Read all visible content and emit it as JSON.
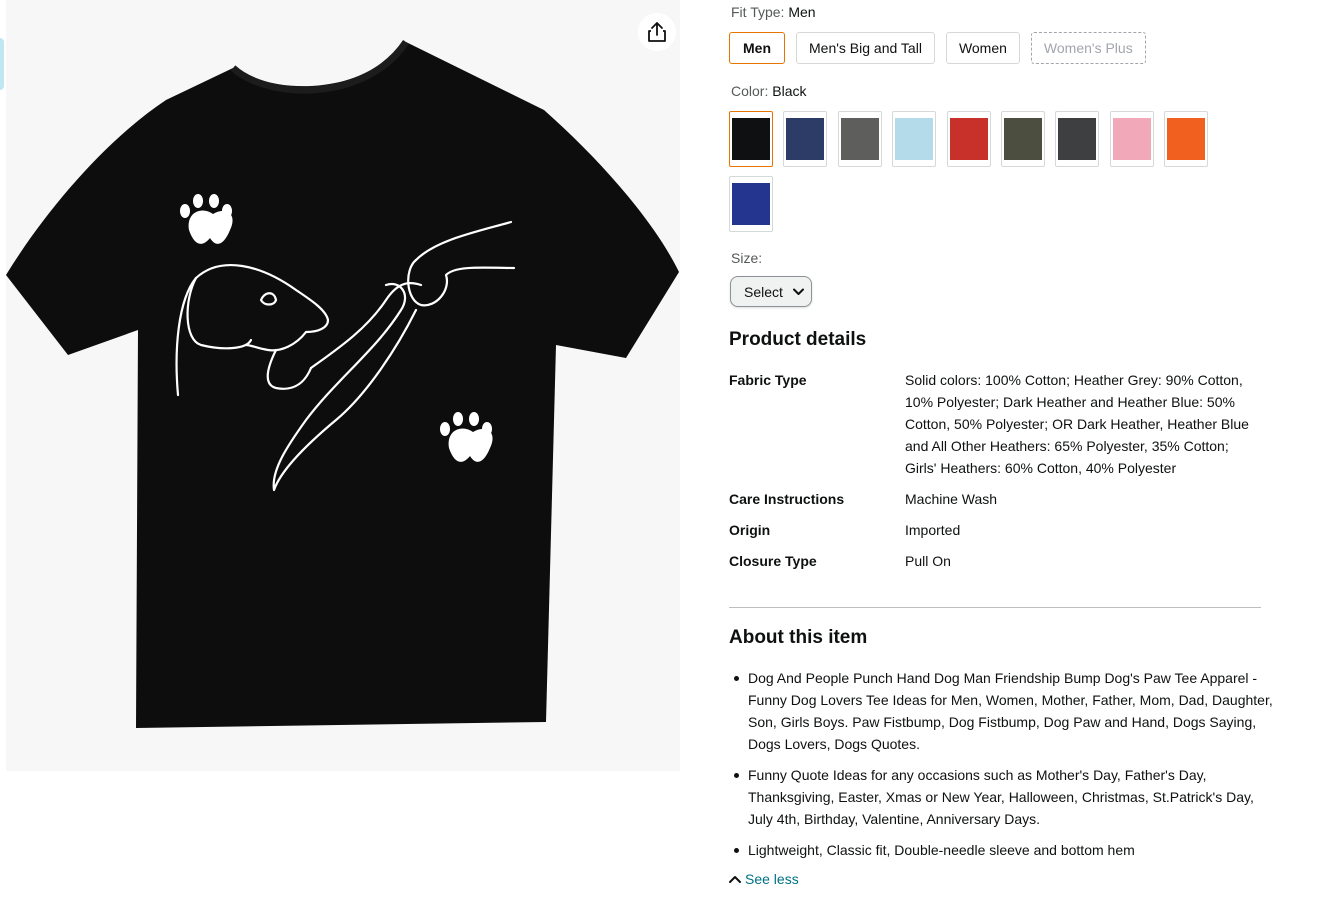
{
  "fit_type": {
    "label": "Fit Type:",
    "value": "Men",
    "options": [
      {
        "label": "Men",
        "state": "selected"
      },
      {
        "label": "Men's Big and Tall",
        "state": "available"
      },
      {
        "label": "Women",
        "state": "available"
      },
      {
        "label": "Women's Plus",
        "state": "unavailable"
      }
    ]
  },
  "color": {
    "label": "Color:",
    "value": "Black",
    "swatches": [
      {
        "name": "Black",
        "hex": "#0e1011",
        "selected": true
      },
      {
        "name": "Navy",
        "hex": "#2c3c66",
        "selected": false
      },
      {
        "name": "Dark Heather",
        "hex": "#5e5f5c",
        "selected": false
      },
      {
        "name": "Baby Blue",
        "hex": "#b4dbea",
        "selected": false
      },
      {
        "name": "Red",
        "hex": "#c8302a",
        "selected": false
      },
      {
        "name": "Olive",
        "hex": "#4c4f40",
        "selected": false
      },
      {
        "name": "Asphalt",
        "hex": "#3d3f40",
        "selected": false
      },
      {
        "name": "Pink",
        "hex": "#f1a8b8",
        "selected": false
      },
      {
        "name": "Orange",
        "hex": "#f1601e",
        "selected": false
      },
      {
        "name": "Royal Blue",
        "hex": "#23358f",
        "selected": false
      }
    ]
  },
  "size": {
    "label": "Size:",
    "select_label": "Select"
  },
  "product_details": {
    "heading": "Product details",
    "rows": [
      {
        "key": "Fabric Type",
        "value": "Solid colors: 100% Cotton; Heather Grey: 90% Cotton, 10% Polyester; Dark Heather and Heather Blue: 50% Cotton, 50% Polyester; OR Dark Heather, Heather Blue and All Other Heathers: 65% Polyester, 35% Cotton; Girls' Heathers: 60% Cotton, 40% Polyester"
      },
      {
        "key": "Care Instructions",
        "value": "Machine Wash"
      },
      {
        "key": "Origin",
        "value": "Imported"
      },
      {
        "key": "Closure Type",
        "value": "Pull On"
      }
    ]
  },
  "about": {
    "heading": "About this item",
    "bullets": [
      "Dog And People Punch Hand Dog Man Friendship Bump Dog's Paw Tee Apparel - Funny Dog Lovers Tee Ideas for Men, Women, Mother, Father, Mom, Dad, Daughter, Son, Girls Boys. Paw Fistbump, Dog Fistbump, Dog Paw and Hand, Dogs Saying, Dogs Lovers, Dogs Quotes.",
      "Funny Quote Ideas for any occasions such as Mother's Day, Father's Day, Thanksgiving, Easter, Xmas or New Year, Halloween, Christmas, St.Patrick's Day, July 4th, Birthday, Valentine, Anniversary Days.",
      "Lightweight, Classic fit, Double-needle sleeve and bottom hem"
    ],
    "see_less": "See less"
  },
  "icons": {
    "share": "share-icon",
    "chevron": "chevron-down-icon",
    "collapse": "chevron-up-icon"
  },
  "accent_colors": {
    "selected_border": "#e77600",
    "link": "#007185"
  }
}
